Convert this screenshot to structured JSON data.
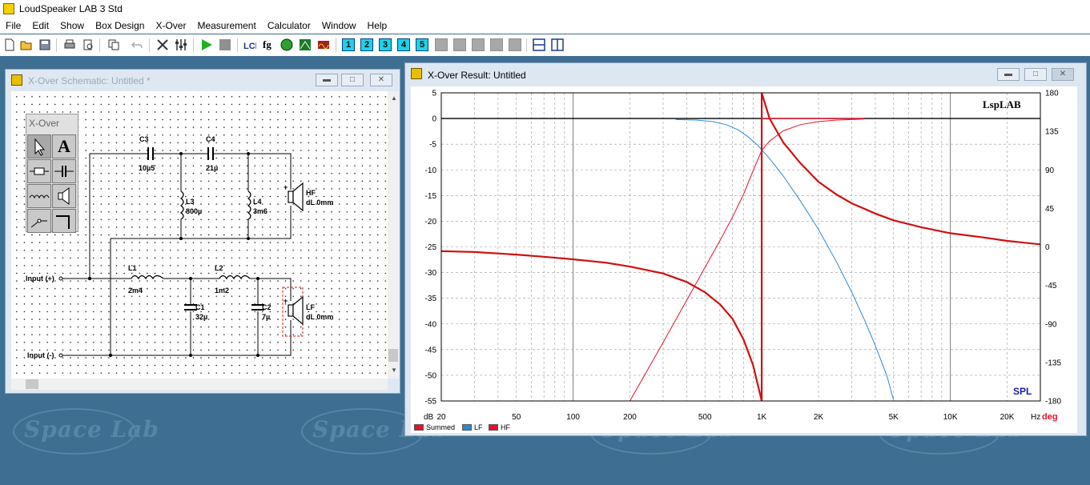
{
  "app": {
    "title": "LoudSpeaker LAB 3 Std"
  },
  "menu": [
    "File",
    "Edit",
    "Show",
    "Box Design",
    "X-Over",
    "Measurement",
    "Calculator",
    "Window",
    "Help"
  ],
  "toolbar": {
    "numbered": [
      "1",
      "2",
      "3",
      "4",
      "5"
    ]
  },
  "schematic": {
    "title": "X-Over Schematic: Untitled *",
    "palette_title": "X-Over",
    "palette_text_tool": "A",
    "components": [
      {
        "ref": "C3",
        "value": "10µ5"
      },
      {
        "ref": "C4",
        "value": "21µ"
      },
      {
        "ref": "L3",
        "value": "800µ"
      },
      {
        "ref": "L4",
        "value": "3m6"
      },
      {
        "ref": "L1",
        "value": "2m4"
      },
      {
        "ref": "L2",
        "value": "1m2"
      },
      {
        "ref": "C1",
        "value": "32µ"
      },
      {
        "ref": "C2",
        "value": "7µ"
      }
    ],
    "drivers": [
      {
        "name": "HF",
        "delay": "dL 0mm"
      },
      {
        "name": "LF",
        "delay": "dL 0mm"
      }
    ],
    "inputs": {
      "pos": "Input (+)",
      "neg": "Input (-)"
    }
  },
  "result": {
    "title": "X-Over Result: Untitled",
    "brand": "LspLAB",
    "mode": "SPL",
    "legend": [
      {
        "name": "Summed",
        "color": "#e8102a"
      },
      {
        "name": "LF",
        "color": "#2a8ad4"
      },
      {
        "name": "HF",
        "color": "#e8102a"
      }
    ]
  },
  "chart_data": {
    "type": "line",
    "x_scale": "log",
    "xlim": [
      20,
      30000
    ],
    "ylim": [
      -55,
      5
    ],
    "y2lim": [
      -180,
      180
    ],
    "x_ticks": [
      20,
      50,
      100,
      200,
      500,
      1000,
      2000,
      5000,
      10000,
      20000
    ],
    "x_tick_labels": [
      "20",
      "50",
      "100",
      "200",
      "500",
      "1K",
      "2K",
      "5K",
      "10K",
      "20K"
    ],
    "y_ticks": [
      5,
      0,
      -5,
      -10,
      -15,
      -20,
      -25,
      -30,
      -35,
      -40,
      -45,
      -50,
      -55
    ],
    "y2_ticks": [
      180,
      135,
      90,
      45,
      0,
      -45,
      -90,
      -135,
      -180
    ],
    "xunit": "Hz",
    "yunit": "dB",
    "y2unit": "deg",
    "grid": true,
    "series": [
      {
        "name": "Summed",
        "color": "#e8102a",
        "x": [
          1000,
          1100,
          1300,
          1600,
          2000,
          2500,
          3000,
          3500
        ],
        "y": [
          0,
          0,
          0,
          0,
          0,
          0,
          0,
          0
        ]
      },
      {
        "name": "LF",
        "color": "#2a8ad4",
        "x": [
          350,
          450,
          550,
          650,
          750,
          850,
          950,
          1100,
          1300,
          1600,
          2000,
          2500,
          3000,
          3500,
          4000,
          4600,
          5000
        ],
        "y": [
          -0.2,
          -0.3,
          -0.6,
          -1.2,
          -2.2,
          -3.6,
          -5.2,
          -7.8,
          -11.2,
          -16,
          -21.6,
          -28,
          -33.8,
          -39.2,
          -44.2,
          -50,
          -54.8
        ]
      },
      {
        "name": "HF",
        "color": "#e8102a",
        "x": [
          200,
          300,
          400,
          500,
          600,
          700,
          800,
          900,
          1000,
          1100,
          1300,
          1600,
          2000,
          2500,
          3000,
          3500
        ],
        "y": [
          -55,
          -43.6,
          -35.4,
          -29,
          -23.8,
          -19.2,
          -14.8,
          -10.2,
          -6.2,
          -4.4,
          -2.4,
          -1.2,
          -0.6,
          -0.3,
          -0.2,
          -0.1
        ]
      },
      {
        "name": "Phase (Summed)",
        "color": "#d01010",
        "axis": "y2",
        "x": [
          20,
          30,
          50,
          70,
          100,
          150,
          200,
          300,
          400,
          500,
          600,
          700,
          800,
          900,
          1000,
          1000,
          1100,
          1300,
          1600,
          2000,
          2500,
          3000,
          4000,
          5000,
          7000,
          10000,
          15000,
          20000,
          30000
        ],
        "y": [
          -5,
          -6,
          -9,
          -11.5,
          -14.5,
          -18.5,
          -23,
          -31,
          -41,
          -53,
          -67,
          -84,
          -108,
          -138,
          -180,
          180,
          150,
          122,
          98,
          76,
          61,
          51,
          39,
          31,
          23,
          16,
          11,
          7,
          3
        ]
      }
    ]
  }
}
